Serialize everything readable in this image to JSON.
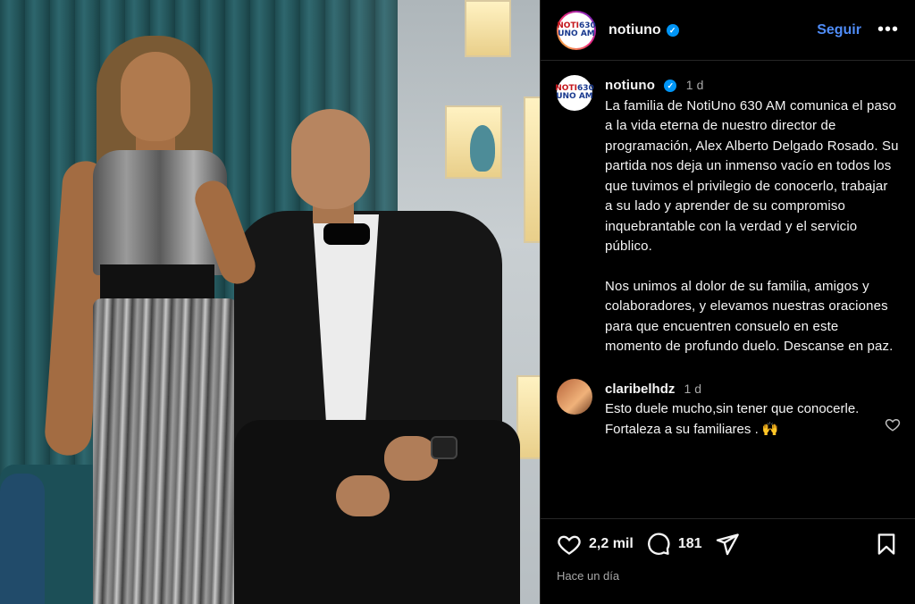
{
  "header": {
    "username": "notiuno",
    "follow_label": "Seguir",
    "more_label": "•••",
    "logo_top": "NOTI",
    "logo_num": "630",
    "logo_bottom": "UNO AM"
  },
  "post": {
    "username": "notiuno",
    "time": "1 d",
    "paragraph1": "La familia de NotiUno 630 AM comunica el paso a la vida eterna de nuestro director de programación, Alex Alberto Delgado Rosado. Su partida nos deja un inmenso vacío en todos los que tuvimos el privilegio de conocerlo, trabajar a su lado y aprender de su compromiso inquebrantable con la verdad y el servicio público.",
    "paragraph2": "Nos unimos al dolor de su familia, amigos y colaboradores, y elevamos nuestras oraciones para que encuentren consuelo en este momento de profundo duelo. Descanse en paz."
  },
  "comment": {
    "username": "claribelhdz",
    "time": "1 d",
    "text": "Esto duele mucho,sin tener que conocerle. Fortaleza a su familiares . 🙌"
  },
  "actions": {
    "likes": "2,2 mil",
    "comments": "181",
    "posted_ago": "Hace un día"
  },
  "icons": {
    "verified": "verified-badge-icon",
    "like": "heart-icon",
    "comment": "comment-bubble-icon",
    "share": "send-icon",
    "save": "bookmark-icon"
  },
  "colors": {
    "accent": "#4f8cf7",
    "verified": "#0095f6",
    "background": "#000000",
    "muted": "#a8a8a8"
  }
}
